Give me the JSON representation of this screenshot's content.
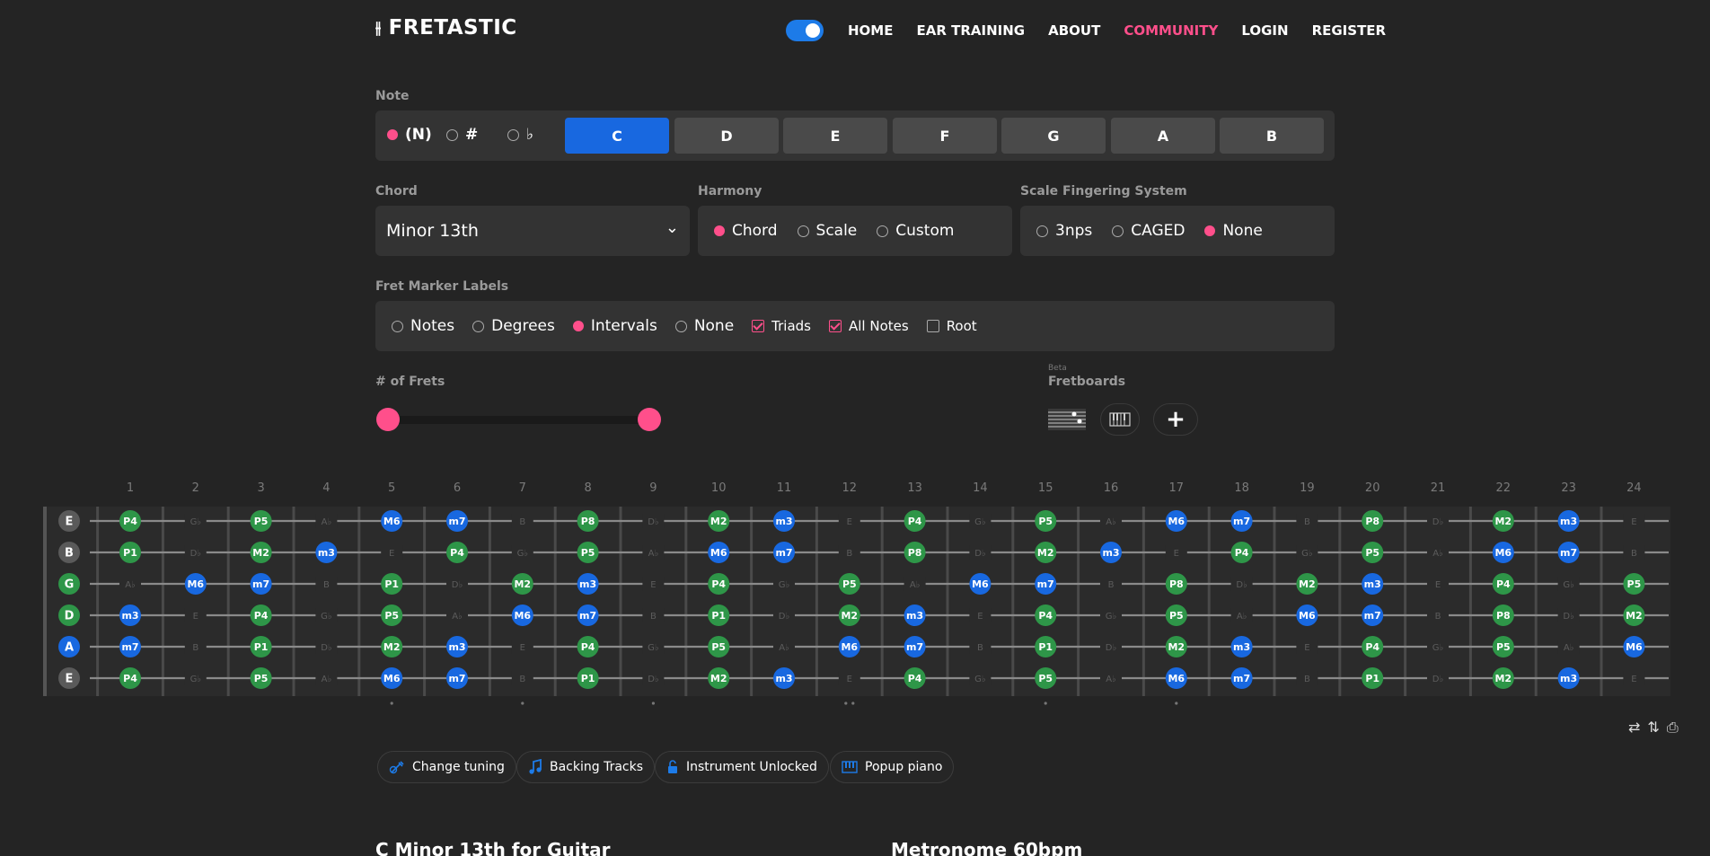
{
  "header": {
    "logo_mark": "⫲",
    "logo_text": "FRETASTIC",
    "nav": [
      "HOME",
      "EAR TRAINING",
      "ABOUT",
      "COMMUNITY",
      "LOGIN",
      "REGISTER"
    ],
    "nav_active": "COMMUNITY",
    "toggle_on": true
  },
  "note": {
    "label": "Note",
    "accidentals": [
      {
        "label": "(N)",
        "selected": true
      },
      {
        "label": "#",
        "selected": false
      },
      {
        "label": "♭",
        "selected": false
      }
    ],
    "buttons": [
      "C",
      "D",
      "E",
      "F",
      "G",
      "A",
      "B"
    ],
    "selected": "C"
  },
  "chord": {
    "label": "Chord",
    "value": "Minor 13th",
    "chevron": "⌄"
  },
  "harmony": {
    "label": "Harmony",
    "options": [
      {
        "label": "Chord",
        "selected": true
      },
      {
        "label": "Scale",
        "selected": false
      },
      {
        "label": "Custom",
        "selected": false
      }
    ]
  },
  "fingering": {
    "label": "Scale Fingering System",
    "options": [
      {
        "label": "3nps",
        "selected": false
      },
      {
        "label": "CAGED",
        "selected": false
      },
      {
        "label": "None",
        "selected": true
      }
    ]
  },
  "fret_labels": {
    "label": "Fret Marker Labels",
    "options": [
      {
        "label": "Notes",
        "selected": false
      },
      {
        "label": "Degrees",
        "selected": false
      },
      {
        "label": "Intervals",
        "selected": true
      },
      {
        "label": "None",
        "selected": false
      }
    ],
    "checks": [
      {
        "label": "Triads",
        "checked": true
      },
      {
        "label": "All Notes",
        "checked": true
      },
      {
        "label": "Root",
        "checked": false
      }
    ]
  },
  "frets": {
    "label": "# of Frets"
  },
  "fretboards": {
    "beta": "Beta",
    "label": "Fretboards",
    "add": "+"
  },
  "fretboard": {
    "fret_numbers": [
      "1",
      "2",
      "3",
      "4",
      "5",
      "6",
      "7",
      "8",
      "9",
      "10",
      "11",
      "12",
      "13",
      "14",
      "15",
      "16",
      "17",
      "18",
      "19",
      "20",
      "21",
      "22",
      "23",
      "24"
    ],
    "strings": [
      {
        "name": "E",
        "color": "#5a5a5a",
        "cells": [
          "P4",
          "G♭",
          "P5",
          "A♭",
          "M6",
          "m7",
          "B",
          "P8",
          "D♭",
          "M2",
          "m3",
          "E",
          "P4",
          "G♭",
          "P5",
          "A♭",
          "M6",
          "m7",
          "B",
          "P8",
          "D♭",
          "M2",
          "m3",
          "E"
        ]
      },
      {
        "name": "B",
        "color": "#5a5a5a",
        "cells": [
          "P1",
          "D♭",
          "M2",
          "m3",
          "E",
          "P4",
          "G♭",
          "P5",
          "A♭",
          "M6",
          "m7",
          "B",
          "P8",
          "D♭",
          "M2",
          "m3",
          "E",
          "P4",
          "G♭",
          "P5",
          "A♭",
          "M6",
          "m7",
          "B"
        ]
      },
      {
        "name": "G",
        "color": "#2e9648",
        "cells": [
          "A♭",
          "M6",
          "m7",
          "B",
          "P1",
          "D♭",
          "M2",
          "m3",
          "E",
          "P4",
          "G♭",
          "P5",
          "A♭",
          "M6",
          "m7",
          "B",
          "P8",
          "D♭",
          "M2",
          "m3",
          "E",
          "P4",
          "G♭",
          "P5"
        ]
      },
      {
        "name": "D",
        "color": "#2e9648",
        "cells": [
          "m3",
          "E",
          "P4",
          "G♭",
          "P5",
          "A♭",
          "M6",
          "m7",
          "B",
          "P1",
          "D♭",
          "M2",
          "m3",
          "E",
          "P4",
          "G♭",
          "P5",
          "A♭",
          "M6",
          "m7",
          "B",
          "P8",
          "D♭",
          "M2"
        ]
      },
      {
        "name": "A",
        "color": "#1868e0",
        "cells": [
          "m7",
          "B",
          "P1",
          "D♭",
          "M2",
          "m3",
          "E",
          "P4",
          "G♭",
          "P5",
          "A♭",
          "M6",
          "m7",
          "B",
          "P1",
          "D♭",
          "M2",
          "m3",
          "E",
          "P4",
          "G♭",
          "P5",
          "A♭",
          "M6"
        ]
      },
      {
        "name": "E",
        "color": "#5a5a5a",
        "cells": [
          "P4",
          "G♭",
          "P5",
          "A♭",
          "M6",
          "m7",
          "B",
          "P1",
          "D♭",
          "M2",
          "m3",
          "E",
          "P4",
          "G♭",
          "P5",
          "A♭",
          "M6",
          "m7",
          "B",
          "P1",
          "D♭",
          "M2",
          "m3",
          "E"
        ]
      }
    ],
    "inlay_frets": [
      5,
      7,
      9,
      12,
      15,
      17
    ],
    "double_inlay_frets": [
      12
    ],
    "colors": {
      "blue": "#1868e0",
      "green": "#2e9648",
      "faint": "#5c5c5c"
    }
  },
  "tools": [
    "⇄",
    "⇅",
    "⎙"
  ],
  "pills": [
    {
      "icon": "guitar-icon",
      "label": "Change tuning"
    },
    {
      "icon": "music-note-icon",
      "label": "Backing Tracks"
    },
    {
      "icon": "unlock-icon",
      "label": "Instrument Unlocked"
    },
    {
      "icon": "piano-icon",
      "label": "Popup piano"
    }
  ],
  "bottom": {
    "left_title": "C Minor 13th for Guitar",
    "right_title": "Metronome 60bpm"
  }
}
